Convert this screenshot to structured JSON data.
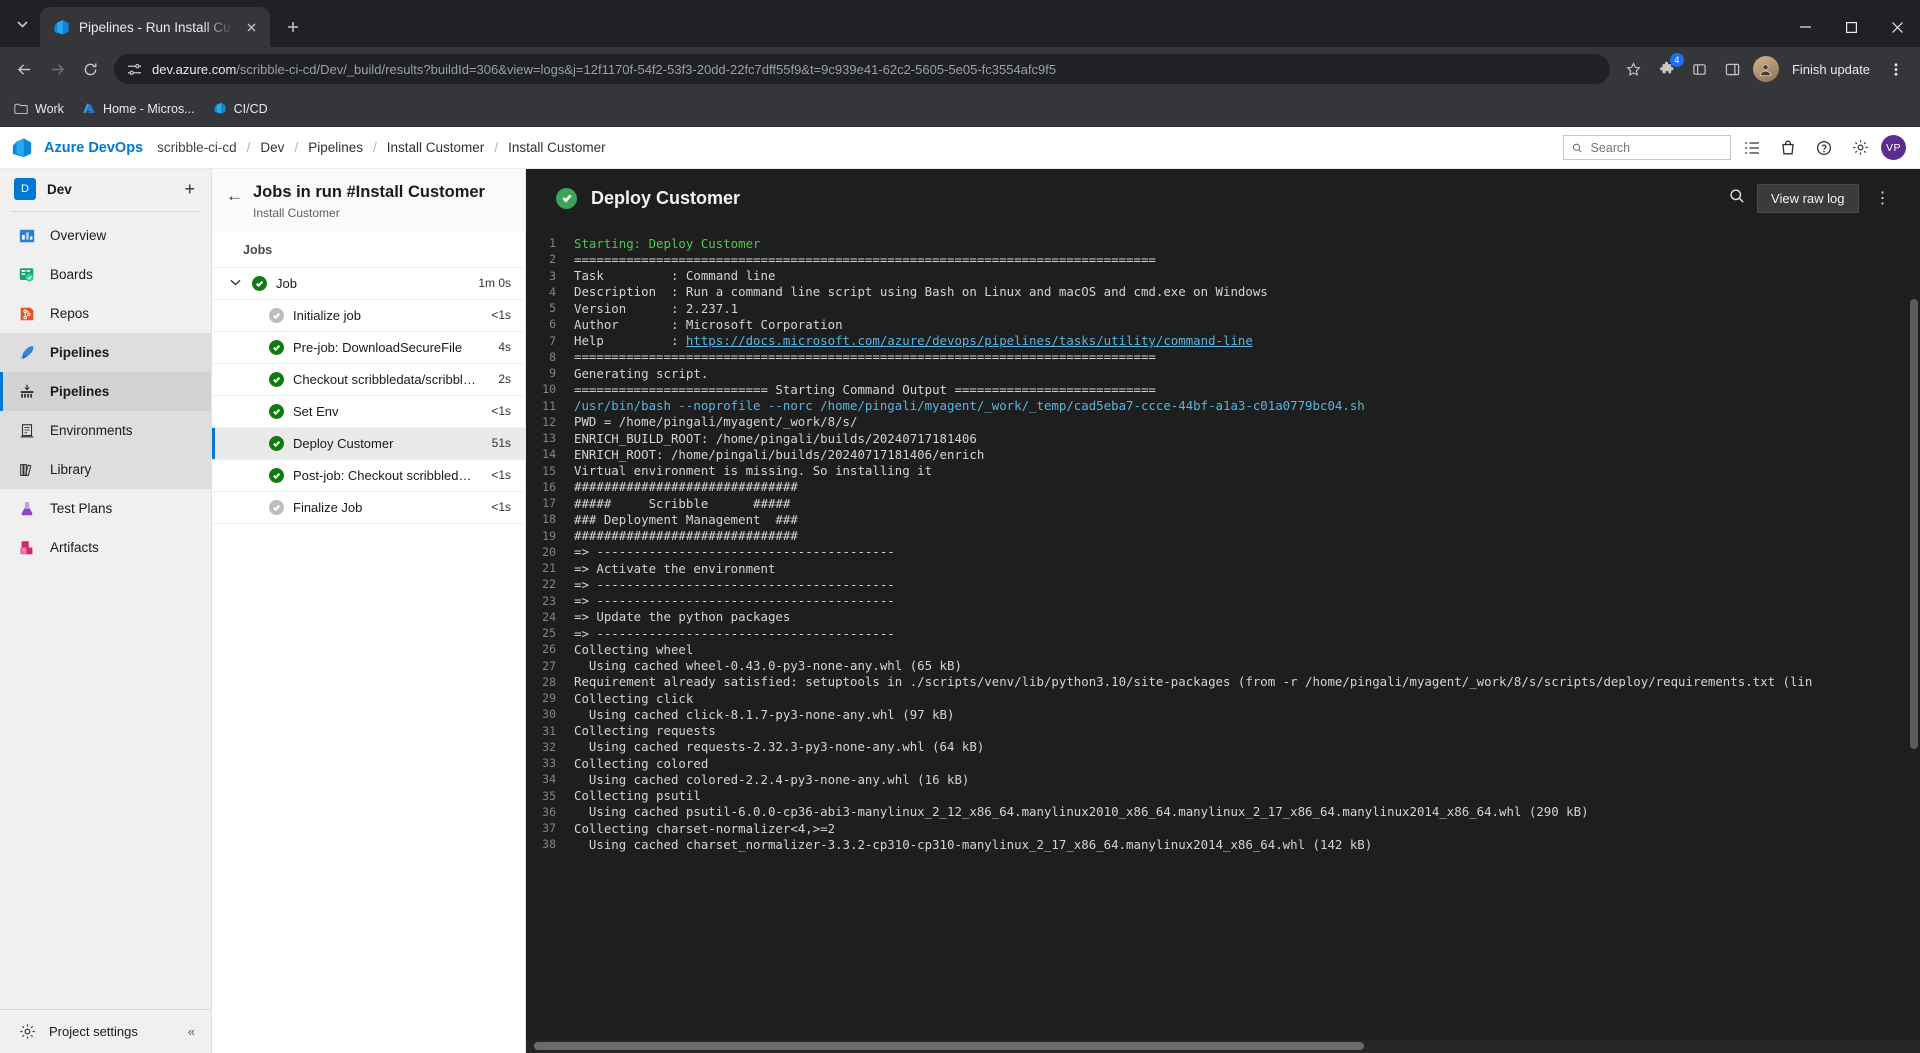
{
  "browser": {
    "tab": {
      "title": "Pipelines - Run Install Cu",
      "favicon": "azure-devops-icon"
    },
    "new_tab_label": "+",
    "url_host": "dev.azure.com",
    "url_path": "/scribble-ci-cd/Dev/_build/results?buildId=306&view=logs&j=12f1170f-54f2-53f3-20dd-22fc7dff55f9&t=9c939e41-62c2-5605-5e05-fc3554afc9f5",
    "extension_badge_count": "4",
    "finish_update_label": "Finish update",
    "bookmarks": [
      {
        "label": "Work",
        "icon": "folder-icon"
      },
      {
        "label": "Home - Micros...",
        "icon": "azure-icon"
      },
      {
        "label": "CI/CD",
        "icon": "azure-devops-icon"
      }
    ]
  },
  "header": {
    "brand": "Azure DevOps",
    "organization": "scribble-ci-cd",
    "breadcrumbs": [
      "Dev",
      "Pipelines",
      "Install Customer",
      "Install Customer"
    ],
    "search_placeholder": "Search",
    "avatar_initials": "VP",
    "icons": [
      "checklist-icon",
      "shopping-bag-icon",
      "help-icon",
      "settings-icon"
    ]
  },
  "sidebar": {
    "project_initial": "D",
    "project_name": "Dev",
    "add_label": "+",
    "items": [
      {
        "label": "Overview",
        "icon": "overview-icon",
        "state": "normal"
      },
      {
        "label": "Boards",
        "icon": "boards-icon",
        "state": "normal"
      },
      {
        "label": "Repos",
        "icon": "repos-icon",
        "state": "normal"
      },
      {
        "label": "Pipelines",
        "icon": "pipelines-icon",
        "state": "group"
      },
      {
        "label": "Pipelines",
        "icon": "pipeline-runs-icon",
        "state": "active"
      },
      {
        "label": "Environments",
        "icon": "environments-icon",
        "state": "sub"
      },
      {
        "label": "Library",
        "icon": "library-icon",
        "state": "sub"
      },
      {
        "label": "Test Plans",
        "icon": "test-plans-icon",
        "state": "normal"
      },
      {
        "label": "Artifacts",
        "icon": "artifacts-icon",
        "state": "normal"
      }
    ],
    "project_settings": "Project settings"
  },
  "jobs_panel": {
    "back_icon": "back-arrow-icon",
    "title": "Jobs in run #Install Customer",
    "subtitle": "Install Customer",
    "section_label": "Jobs",
    "rows": [
      {
        "name": "Job",
        "duration": "1m 0s",
        "status": "ok",
        "level": "parent",
        "selected": false
      },
      {
        "name": "Initialize job",
        "duration": "<1s",
        "status": "skip",
        "level": "child",
        "selected": false
      },
      {
        "name": "Pre-job: DownloadSecureFile",
        "duration": "4s",
        "status": "ok",
        "level": "child",
        "selected": false
      },
      {
        "name": "Checkout scribbledata/scribble-ci...",
        "duration": "2s",
        "status": "ok",
        "level": "child",
        "selected": false
      },
      {
        "name": "Set Env",
        "duration": "<1s",
        "status": "ok",
        "level": "child",
        "selected": false
      },
      {
        "name": "Deploy Customer",
        "duration": "51s",
        "status": "ok",
        "level": "child",
        "selected": true
      },
      {
        "name": "Post-job: Checkout scribbledata...",
        "duration": "<1s",
        "status": "ok",
        "level": "child",
        "selected": false
      },
      {
        "name": "Finalize Job",
        "duration": "<1s",
        "status": "skip",
        "level": "child",
        "selected": false
      }
    ]
  },
  "log_view": {
    "status": "succeeded",
    "title": "Deploy Customer",
    "search_icon": "search-icon",
    "raw_log_button": "View raw log",
    "more_icon": "more-vertical-icon",
    "lines": [
      {
        "n": "1",
        "t": "Starting: Deploy Customer",
        "c": "green"
      },
      {
        "n": "2",
        "t": "==============================================================================",
        "c": ""
      },
      {
        "n": "3",
        "t": "Task         : Command line",
        "c": ""
      },
      {
        "n": "4",
        "t": "Description  : Run a command line script using Bash on Linux and macOS and cmd.exe on Windows",
        "c": ""
      },
      {
        "n": "5",
        "t": "Version      : 2.237.1",
        "c": ""
      },
      {
        "n": "6",
        "t": "Author       : Microsoft Corporation",
        "c": ""
      },
      {
        "n": "7",
        "t": "Help         : https://docs.microsoft.com/azure/devops/pipelines/tasks/utility/command-line",
        "c": "link"
      },
      {
        "n": "8",
        "t": "==============================================================================",
        "c": ""
      },
      {
        "n": "9",
        "t": "Generating script.",
        "c": ""
      },
      {
        "n": "10",
        "t": "========================== Starting Command Output ===========================",
        "c": ""
      },
      {
        "n": "11",
        "t": "/usr/bin/bash --noprofile --norc /home/pingali/myagent/_work/_temp/cad5eba7-ccce-44bf-a1a3-c01a0779bc04.sh",
        "c": "cyan"
      },
      {
        "n": "12",
        "t": "PWD = /home/pingali/myagent/_work/8/s/",
        "c": ""
      },
      {
        "n": "13",
        "t": "ENRICH_BUILD_ROOT: /home/pingali/builds/20240717181406",
        "c": ""
      },
      {
        "n": "14",
        "t": "ENRICH_ROOT: /home/pingali/builds/20240717181406/enrich",
        "c": ""
      },
      {
        "n": "15",
        "t": "Virtual environment is missing. So installing it",
        "c": ""
      },
      {
        "n": "16",
        "t": "##############################",
        "c": ""
      },
      {
        "n": "17",
        "t": "#####     Scribble      #####",
        "c": ""
      },
      {
        "n": "18",
        "t": "### Deployment Management  ###",
        "c": ""
      },
      {
        "n": "19",
        "t": "##############################",
        "c": ""
      },
      {
        "n": "20",
        "t": "=> ----------------------------------------",
        "c": ""
      },
      {
        "n": "21",
        "t": "=> Activate the environment",
        "c": ""
      },
      {
        "n": "22",
        "t": "=> ----------------------------------------",
        "c": ""
      },
      {
        "n": "23",
        "t": "=> ----------------------------------------",
        "c": ""
      },
      {
        "n": "24",
        "t": "=> Update the python packages",
        "c": ""
      },
      {
        "n": "25",
        "t": "=> ----------------------------------------",
        "c": ""
      },
      {
        "n": "26",
        "t": "Collecting wheel",
        "c": ""
      },
      {
        "n": "27",
        "t": "  Using cached wheel-0.43.0-py3-none-any.whl (65 kB)",
        "c": ""
      },
      {
        "n": "28",
        "t": "Requirement already satisfied: setuptools in ./scripts/venv/lib/python3.10/site-packages (from -r /home/pingali/myagent/_work/8/s/scripts/deploy/requirements.txt (lin",
        "c": ""
      },
      {
        "n": "29",
        "t": "Collecting click",
        "c": ""
      },
      {
        "n": "30",
        "t": "  Using cached click-8.1.7-py3-none-any.whl (97 kB)",
        "c": ""
      },
      {
        "n": "31",
        "t": "Collecting requests",
        "c": ""
      },
      {
        "n": "32",
        "t": "  Using cached requests-2.32.3-py3-none-any.whl (64 kB)",
        "c": ""
      },
      {
        "n": "33",
        "t": "Collecting colored",
        "c": ""
      },
      {
        "n": "34",
        "t": "  Using cached colored-2.2.4-py3-none-any.whl (16 kB)",
        "c": ""
      },
      {
        "n": "35",
        "t": "Collecting psutil",
        "c": ""
      },
      {
        "n": "36",
        "t": "  Using cached psutil-6.0.0-cp36-abi3-manylinux_2_12_x86_64.manylinux2010_x86_64.manylinux_2_17_x86_64.manylinux2014_x86_64.whl (290 kB)",
        "c": ""
      },
      {
        "n": "37",
        "t": "Collecting charset-normalizer<4,>=2",
        "c": ""
      },
      {
        "n": "38",
        "t": "  Using cached charset_normalizer-3.3.2-cp310-cp310-manylinux_2_17_x86_64.manylinux2014_x86_64.whl (142 kB)",
        "c": ""
      }
    ]
  },
  "colors": {
    "accent": "#0078d4",
    "success": "#107c10",
    "log_bg": "#1e1e1e",
    "green_text": "#4ec94e",
    "cyan_text": "#56b6e0"
  }
}
